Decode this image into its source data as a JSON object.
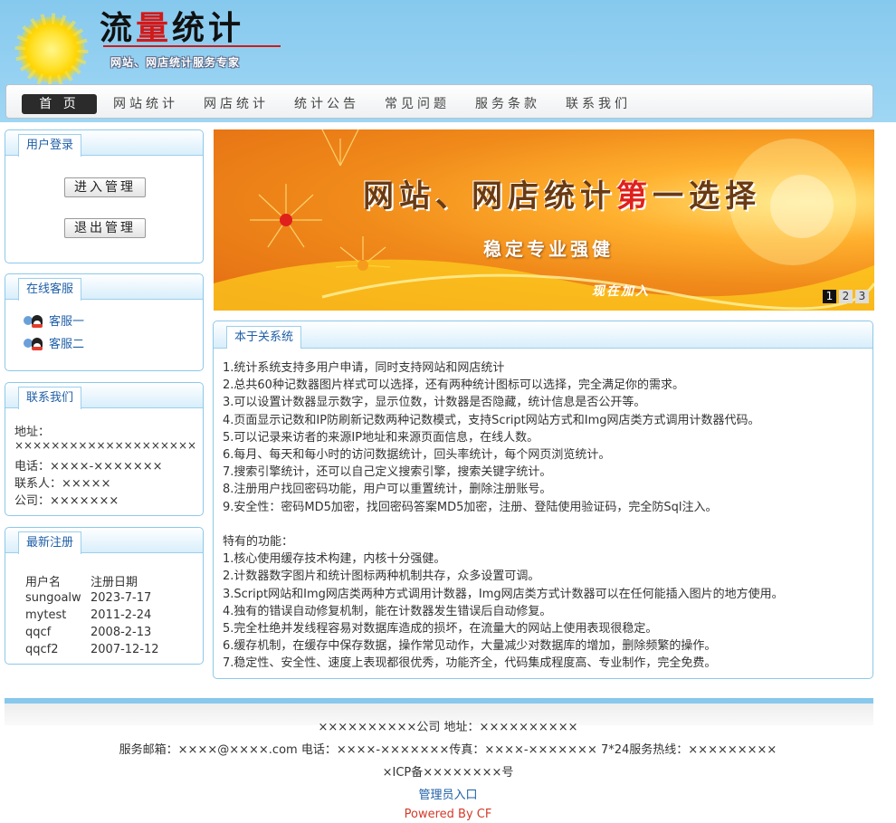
{
  "header": {
    "logo_title_a": "流",
    "logo_title_b": "量",
    "logo_title_c": "统计",
    "logo_subtitle": "网站、网店统计服务专家"
  },
  "nav": {
    "items": [
      "首 页",
      "网站统计",
      "网店统计",
      "统计公告",
      "常见问题",
      "服务条款",
      "联系我们"
    ]
  },
  "login": {
    "tab": "用户登录",
    "enter_button": "进入管理",
    "exit_button": "退出管理"
  },
  "service": {
    "tab": "在线客服",
    "items": [
      "客服一",
      "客服二"
    ]
  },
  "contact": {
    "tab": "联系我们",
    "lines": [
      "地址：",
      "××××××××××××××××××××",
      "电话：××××-×××××××",
      "联系人：×××××",
      "公司：×××××××"
    ]
  },
  "registrations": {
    "tab": "最新注册",
    "col_user": "用户名",
    "col_date": "注册日期",
    "rows": [
      {
        "user": "sungoalw",
        "date": "2023-7-17"
      },
      {
        "user": "mytest",
        "date": "2011-2-24"
      },
      {
        "user": "qqcf",
        "date": "2008-2-13"
      },
      {
        "user": "qqcf2",
        "date": "2007-12-12"
      }
    ]
  },
  "banner": {
    "title_a": "网站、网店统计",
    "title_hl": "第",
    "title_b": "一选择",
    "subtitle": "稳定专业强健",
    "join": "现在加入",
    "pages": [
      "1",
      "2",
      "3"
    ],
    "active_page": "1"
  },
  "about": {
    "tab": "本于关系统",
    "lines": [
      "1.统计系统支持多用户申请，同时支持网站和网店统计",
      "2.总共60种记数器图片样式可以选择，还有两种统计图标可以选择，完全满足你的需求。",
      "3.可以设置计数器显示数字，显示位数，计数器是否隐藏，统计信息是否公开等。",
      "4.页面显示记数和IP防刷新记数两种记数模式，支持Script网站方式和Img网店类方式调用计数器代码。",
      "5.可以记录来访者的来源IP地址和来源页面信息，在线人数。",
      "6.每月、每天和每小时的访问数据统计，回头率统计，每个网页浏览统计。",
      "7.搜索引擎统计，还可以自己定义搜索引擎，搜索关键字统计。",
      "8.注册用户找回密码功能，用户可以重置统计，删除注册账号。",
      "9.安全性：密码MD5加密，找回密码答案MD5加密，注册、登陆使用验证码，完全防Sql注入。",
      "",
      "特有的功能：",
      "1.核心使用缓存技术构建，内核十分强健。",
      "2.计数器数字图片和统计图标两种机制共存，众多设置可调。",
      "3.Script网站和Img网店类两种方式调用计数器，Img网店类方式计数器可以在任何能插入图片的地方使用。",
      "4.独有的错误自动修复机制，能在计数器发生错误后自动修复。",
      "5.完全杜绝并发线程容易对数据库造成的损坏，在流量大的网站上使用表现很稳定。",
      "6.缓存机制，在缓存中保存数据，操作常见动作，大量减少对数据库的增加，删除频繁的操作。",
      "7.稳定性、安全性、速度上表现都很优秀，功能齐全，代码集成程度高、专业制作，完全免费。"
    ]
  },
  "footer": {
    "line1": "××××××××××公司 地址：××××××××××",
    "line2": "服务邮箱：××××@××××.com 电话：××××-×××××××传真：××××-××××××× 7*24服务热线：×××××××××",
    "line3": "×ICP备××××××××号",
    "admin_link": "管理员入口",
    "powered": "Powered By CF"
  },
  "colors": {
    "accent": "#1f5fa8",
    "panel_border": "#8dc8ea",
    "top_band": "#86c9ee",
    "powered": "#d43a2a"
  }
}
